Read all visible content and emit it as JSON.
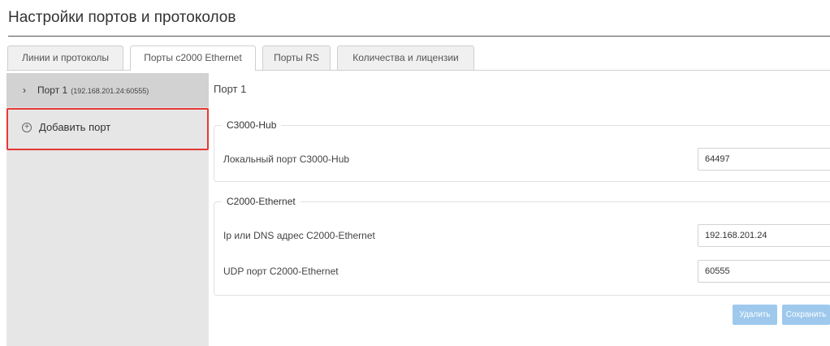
{
  "page": {
    "title": "Настройки портов и протоколов"
  },
  "tabs": [
    {
      "label": "Линии и протоколы"
    },
    {
      "label": "Порты с2000 Ethernet",
      "active": true
    },
    {
      "label": "Порты RS"
    },
    {
      "label": "Количества и лицензии"
    }
  ],
  "sidebar": {
    "port_item": {
      "label": "Порт 1",
      "address": "(192.168.201.24:60555)"
    },
    "add_item": {
      "label": "Добавить порт"
    }
  },
  "content": {
    "title": "Порт 1",
    "c3000_hub": {
      "legend": "C3000-Hub",
      "local_port_label": "Локальный порт С3000-Hub",
      "local_port_value": "64497"
    },
    "c2000_ethernet": {
      "legend": "С2000-Ethernet",
      "ip_label": "Ip или DNS адрес С2000-Ethernet",
      "ip_value": "192.168.201.24",
      "udp_label": "UDP порт С2000-Ethernet",
      "udp_value": "60555"
    },
    "buttons": {
      "delete": "Удалить",
      "save": "Сохранить"
    }
  },
  "colors": {
    "highlight": "#e53935",
    "button": "#9ec9ed",
    "sidebar": "#e6e6e6",
    "sidebar_selected": "#d2d2d2"
  },
  "icons": {
    "expand": "chevron-right-icon",
    "add": "plus-circle-icon"
  }
}
